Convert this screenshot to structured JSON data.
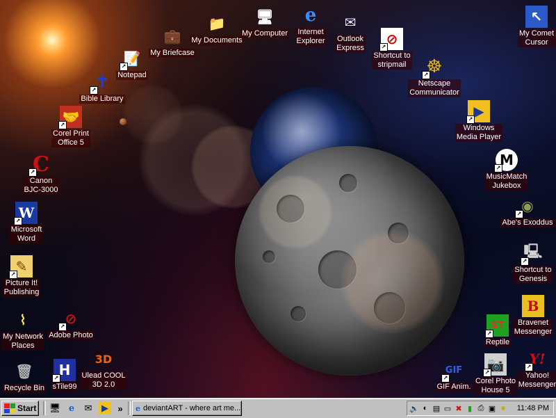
{
  "desktop": {
    "icons": [
      {
        "id": "my-briefcase",
        "label": "My Briefcase",
        "glyph": "💼",
        "shortcut": false
      },
      {
        "id": "my-documents",
        "label": "My Documents",
        "glyph": "📁",
        "shortcut": false
      },
      {
        "id": "my-computer",
        "label": "My Computer",
        "glyph": "🖥",
        "shortcut": false
      },
      {
        "id": "internet-explorer",
        "label": "Internet\nExplorer",
        "glyph": "e",
        "shortcut": false
      },
      {
        "id": "outlook-express",
        "label": "Outlook\nExpress",
        "glyph": "✉",
        "shortcut": false
      },
      {
        "id": "stripmail",
        "label": "Shortcut to\nstripmail",
        "glyph": "⊘",
        "shortcut": true
      },
      {
        "id": "my-comet-cursor",
        "label": "My Comet\nCursor",
        "glyph": "↖",
        "shortcut": false
      },
      {
        "id": "notepad",
        "label": "Notepad",
        "glyph": "📝",
        "shortcut": true
      },
      {
        "id": "bible-library",
        "label": "Bible Library",
        "glyph": "✝",
        "shortcut": true
      },
      {
        "id": "netscape",
        "label": "Netscape\nCommunicator",
        "glyph": "☸",
        "shortcut": true
      },
      {
        "id": "corel-print-office",
        "label": "Corel Print\nOffice 5",
        "glyph": "🤝",
        "shortcut": true
      },
      {
        "id": "media-player",
        "label": "Windows\nMedia Player",
        "glyph": "▶",
        "shortcut": true
      },
      {
        "id": "canon",
        "label": "Canon\nBJC-3000",
        "glyph": "C",
        "shortcut": true
      },
      {
        "id": "musicmatch",
        "label": "MusicMatch\nJukebox",
        "glyph": "M",
        "shortcut": true
      },
      {
        "id": "abes-exoddus",
        "label": "Abe's Exoddus",
        "glyph": "◉",
        "shortcut": true
      },
      {
        "id": "microsoft-word",
        "label": "Microsoft\nWord",
        "glyph": "W",
        "shortcut": true
      },
      {
        "id": "genesis",
        "label": "Shortcut to\nGenesis",
        "glyph": "🖳",
        "shortcut": true
      },
      {
        "id": "picture-it",
        "label": "Picture It!\nPublishing",
        "glyph": "✎",
        "shortcut": true
      },
      {
        "id": "bravenet",
        "label": "Bravenet\nMessenger",
        "glyph": "B",
        "shortcut": false
      },
      {
        "id": "my-network-places",
        "label": "My Network\nPlaces",
        "glyph": "⌇",
        "shortcut": false
      },
      {
        "id": "adobe-photo",
        "label": "Adobe Photo",
        "glyph": "⊘",
        "shortcut": true
      },
      {
        "id": "reptile",
        "label": "Reptile",
        "glyph": "ST",
        "shortcut": true
      },
      {
        "id": "recycle-bin",
        "label": "Recycle Bin",
        "glyph": "🗑",
        "shortcut": false
      },
      {
        "id": "stile99",
        "label": "sTile99",
        "glyph": "H",
        "shortcut": true
      },
      {
        "id": "ulead-cool-3d",
        "label": "Ulead COOL\n3D 2.0",
        "glyph": "3D",
        "shortcut": false
      },
      {
        "id": "gif-anim",
        "label": "GIF Anim.",
        "glyph": "GIF",
        "shortcut": true
      },
      {
        "id": "corel-photo-house",
        "label": "Corel Photo\nHouse 5",
        "glyph": "📷",
        "shortcut": true
      },
      {
        "id": "yahoo-messenger",
        "label": "Yahoo!\nMessenger",
        "glyph": "Y!",
        "shortcut": true
      }
    ]
  },
  "taskbar": {
    "start_label": "Start",
    "quick_launch_more": "»",
    "active_task": "deviantART - where art me...",
    "clock": "11:48 PM",
    "tray_icons": [
      "speaker-icon",
      "mouse-icon",
      "network-icon",
      "monitor-icon",
      "x-icon",
      "battery-icon",
      "printer-icon",
      "display-icon",
      "star-icon"
    ]
  },
  "colors": {
    "label_bg": "#3c0000",
    "taskbar": "#c0c0c0"
  }
}
